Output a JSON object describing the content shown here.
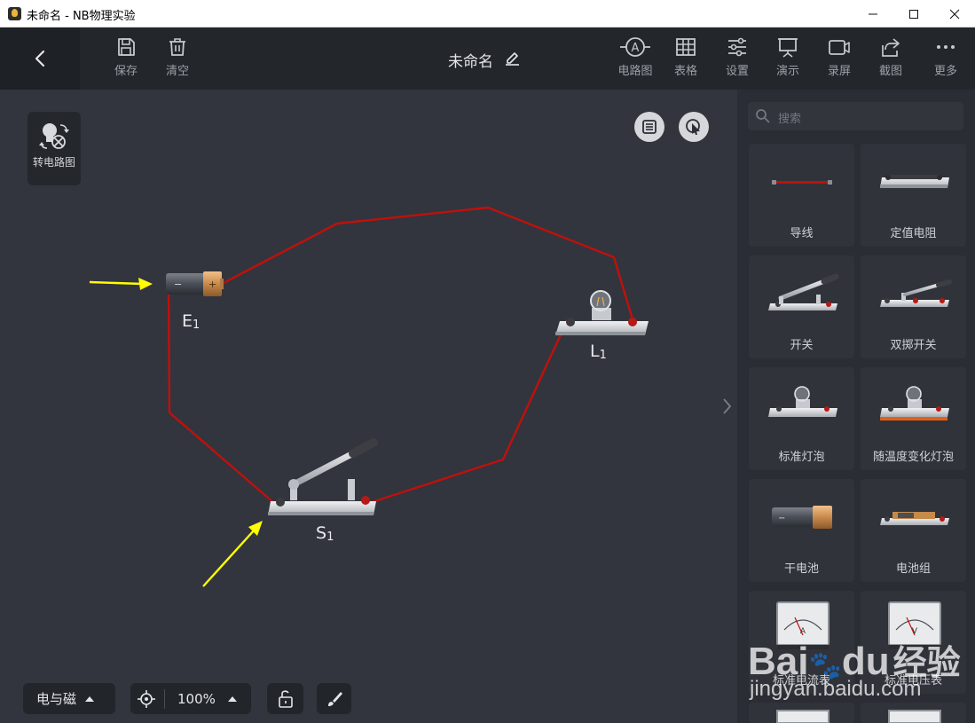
{
  "window": {
    "title": "未命名 - NB物理实验",
    "controls": [
      "minimize",
      "maximize",
      "close"
    ]
  },
  "toolbar": {
    "back_icon": "chevron-left-icon",
    "left_tools": [
      {
        "label": "保存",
        "icon": "save-icon"
      },
      {
        "label": "清空",
        "icon": "trash-icon"
      }
    ],
    "doc_title": "未命名",
    "right_tools": [
      {
        "label": "电路图",
        "icon": "ammeter-circle-icon"
      },
      {
        "label": "表格",
        "icon": "table-icon"
      },
      {
        "label": "设置",
        "icon": "sliders-icon"
      },
      {
        "label": "演示",
        "icon": "presentation-icon"
      },
      {
        "label": "录屏",
        "icon": "video-camera-icon"
      },
      {
        "label": "截图",
        "icon": "share-icon"
      },
      {
        "label": "更多",
        "icon": "more-dots-icon"
      }
    ]
  },
  "canvas": {
    "convert_button_label": "转电路图",
    "components": [
      {
        "name": "E",
        "sub": "1",
        "type": "dry-battery"
      },
      {
        "name": "L",
        "sub": "1",
        "type": "bulb"
      },
      {
        "name": "S",
        "sub": "1",
        "type": "switch"
      }
    ],
    "wire_color": "#c0100c",
    "annotation_color": "#ffff00"
  },
  "bottom_bar": {
    "category": "电与磁",
    "zoom": "100%"
  },
  "sidebar": {
    "search_placeholder": "搜索",
    "items": [
      {
        "label": "导线",
        "icon": "wire-icon"
      },
      {
        "label": "定值电阻",
        "icon": "resistor-icon"
      },
      {
        "label": "开关",
        "icon": "switch-icon"
      },
      {
        "label": "双掷开关",
        "icon": "double-throw-switch-icon"
      },
      {
        "label": "标准灯泡",
        "icon": "bulb-icon"
      },
      {
        "label": "随温度变化灯泡",
        "icon": "bulb-thermal-icon"
      },
      {
        "label": "干电池",
        "icon": "battery-icon"
      },
      {
        "label": "电池组",
        "icon": "battery-pack-icon"
      },
      {
        "label": "标准电流表",
        "icon": "ammeter-icon"
      },
      {
        "label": "标准电压表",
        "icon": "voltmeter-icon"
      }
    ]
  },
  "watermark": {
    "brand_a": "Bai",
    "brand_b": "du",
    "brand_c": "经验",
    "url": "jingyan.baidu.com"
  },
  "colors": {
    "accent": "#c0100c",
    "canvas": "#32353d",
    "toolbar": "#23262b"
  }
}
